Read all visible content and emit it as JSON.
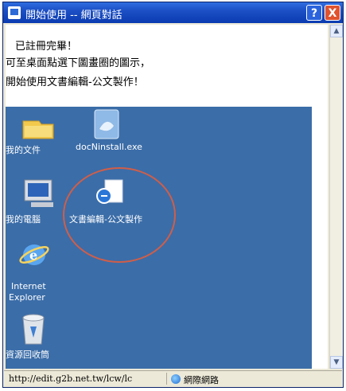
{
  "window": {
    "title": "開始使用 -- 網頁對話",
    "help_label": "?",
    "close_label": "X"
  },
  "content": {
    "line1": "已註冊完畢！",
    "line2": "可至桌面點選下圖畫圈的圖示，",
    "line3": "開始使用文書編輯-公文製作！"
  },
  "desktop_icons": [
    {
      "label": "我的文件",
      "icon": "my-documents-icon"
    },
    {
      "label": "docNinstall.exe",
      "icon": "installer-icon"
    },
    {
      "label": "我的電腦",
      "icon": "my-computer-icon"
    },
    {
      "label": "文書編輯-公文製作",
      "icon": "document-editor-icon"
    },
    {
      "label": "Internet",
      "icon": "internet-explorer-icon"
    },
    {
      "label": "Explorer",
      "icon": "internet-explorer-icon"
    },
    {
      "label": "資源回收筒",
      "icon": "recycle-bin-icon"
    }
  ],
  "statusbar": {
    "url": "http://edit.g2b.net.tw/lcw/lc",
    "zone": "網際網路",
    "zone_icon": "internet-zone-icon"
  },
  "colors": {
    "title_bar": "#1c4fc5",
    "desktop": "#3b6da8",
    "highlight_circle": "#d05e48",
    "close_button": "#e0532e"
  }
}
